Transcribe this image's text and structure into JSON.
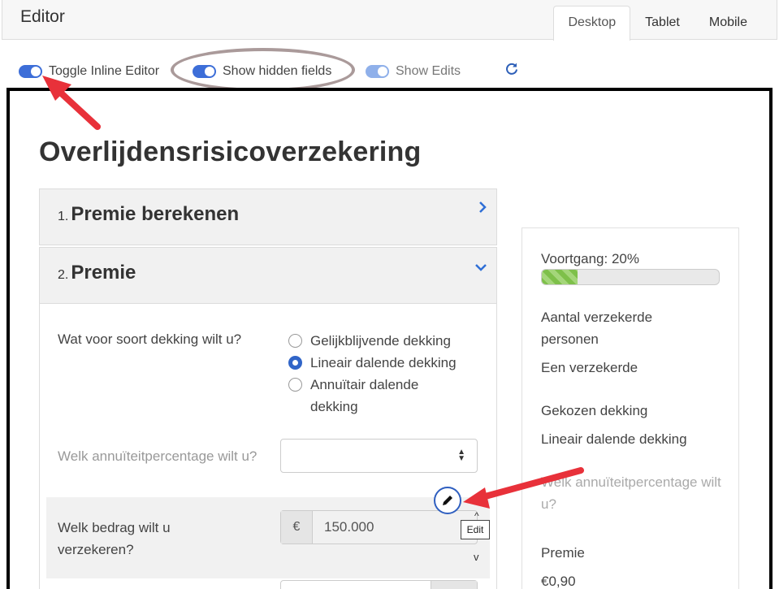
{
  "editor": {
    "title": "Editor"
  },
  "view_tabs": [
    "Desktop",
    "Tablet",
    "Mobile"
  ],
  "toolbar": {
    "toggle_inline": "Toggle Inline Editor",
    "show_hidden": "Show hidden fields",
    "show_edits": "Show Edits"
  },
  "form": {
    "title": "Overlijdensrisicoverzekering",
    "panels": [
      {
        "num": "1.",
        "title": "Premie berekenen",
        "chevron": "chevron-right-icon"
      },
      {
        "num": "2.",
        "title": "Premie",
        "chevron": "chevron-down-icon"
      }
    ],
    "q1": "Wat voor soort dekking wilt u?",
    "options": [
      "Gelijkblijvende dekking",
      "Lineair dalende dekking",
      "Annuïtair dalende dekking"
    ],
    "selected_option": "Lineair dalende dekking",
    "q2": "Welk annuïteitpercentage wilt u?",
    "q3": "Welk bedrag wilt u verzekeren?",
    "currency": "€",
    "amount": "150.000",
    "edit_tooltip": "Edit"
  },
  "sidebar": {
    "progress_label": "Voortgang: 20%",
    "progress_value": 0.2,
    "items": [
      {
        "label": "Aantal verzekerde personen",
        "value": "Een verzekerde"
      },
      {
        "label": "Gekozen dekking",
        "value": "Lineair dalende dekking"
      },
      {
        "label": "Welk annuïteitpercentage wilt u?",
        "value": ""
      },
      {
        "label": "Premie",
        "value": "€0,90"
      }
    ]
  },
  "colors": {
    "accent": "#3165c8",
    "annotation_red": "#e8313a",
    "progress_green": "#7ec04a"
  }
}
